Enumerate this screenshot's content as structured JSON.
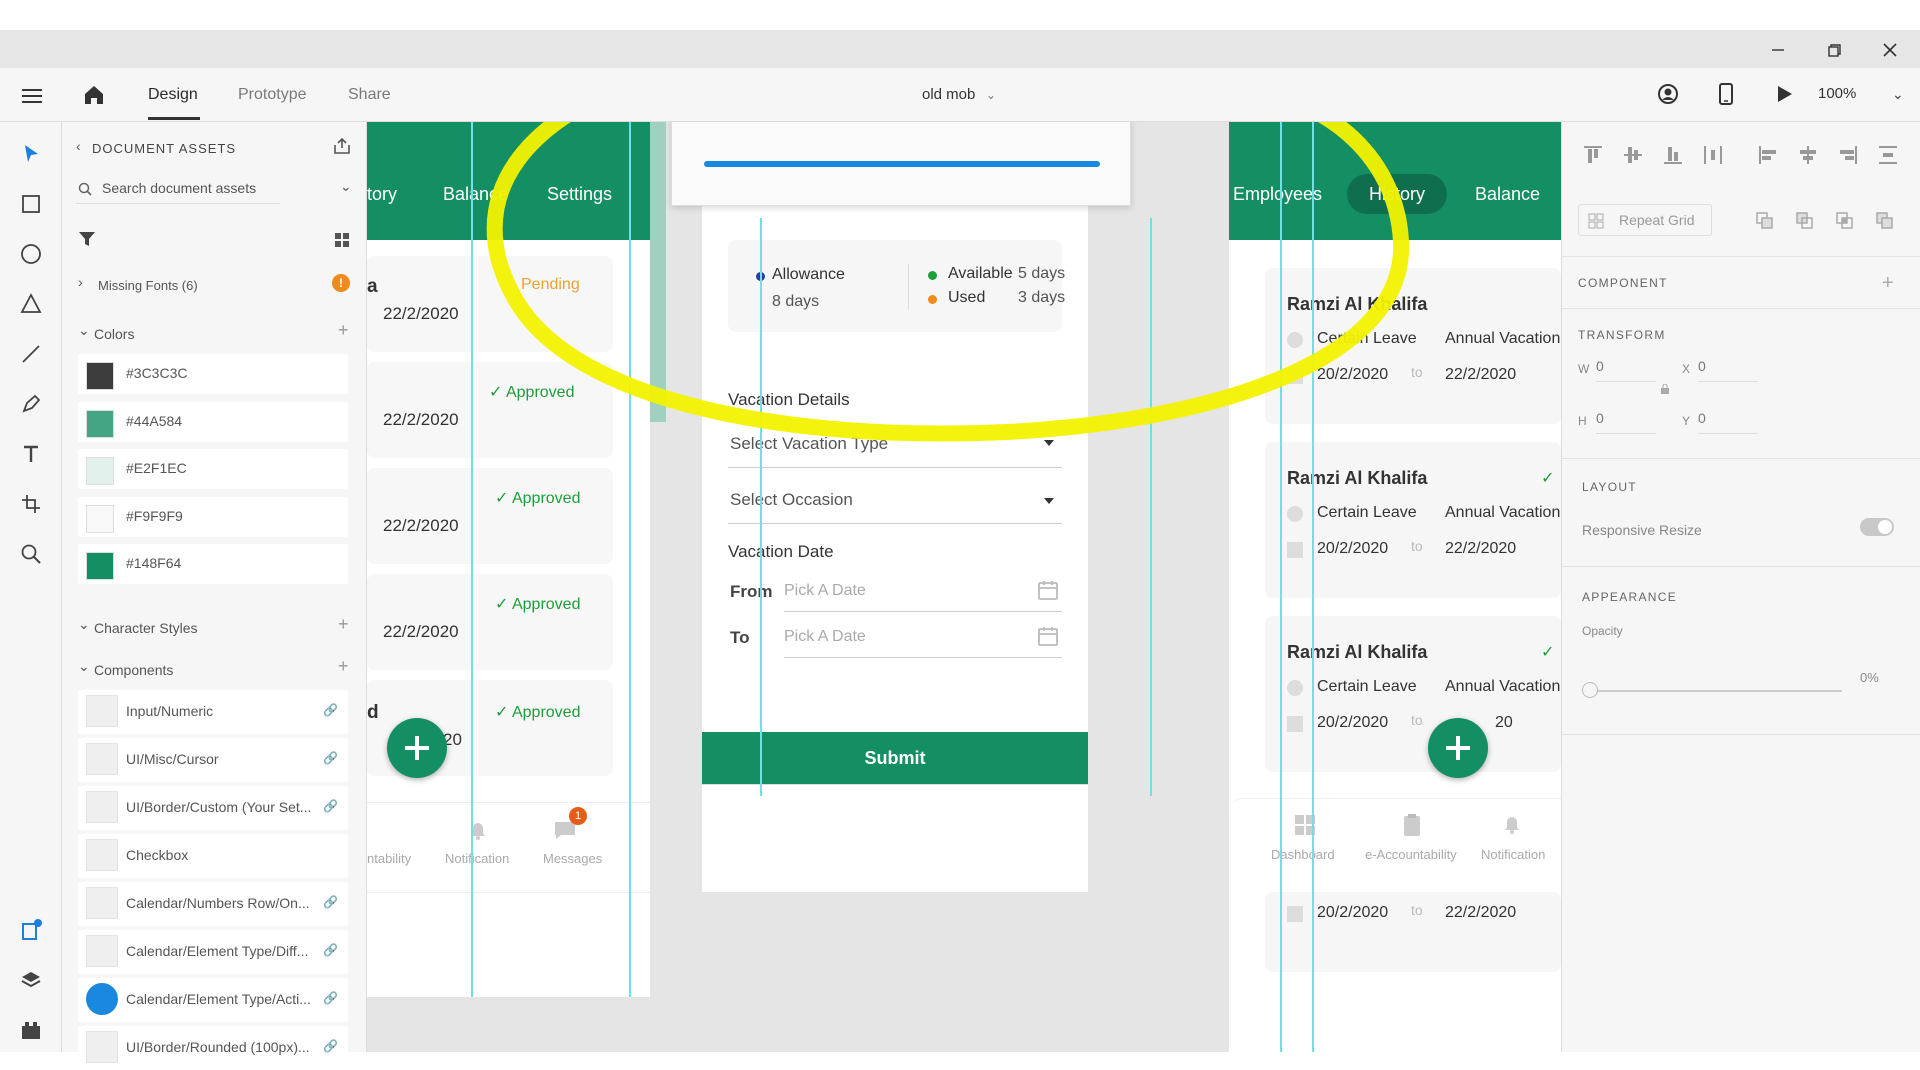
{
  "window": {
    "file_name": "old mob",
    "zoom": "100%"
  },
  "topbar": {
    "tabs": [
      "Design",
      "Prototype",
      "Share"
    ]
  },
  "tools": [
    "select-icon",
    "rectangle-icon",
    "ellipse-icon",
    "polygon-icon",
    "line-icon",
    "pen-icon",
    "text-icon",
    "artboard-icon",
    "zoom-icon",
    "plugins-icon",
    "layers-icon",
    "assets-icon"
  ],
  "assets": {
    "title": "DOCUMENT ASSETS",
    "search_placeholder": "Search document assets",
    "missing_fonts": "Missing Fonts (6)",
    "colors_label": "Colors",
    "colors": [
      "#3C3C3C",
      "#44A584",
      "#E2F1EC",
      "#F9F9F9",
      "#148F64"
    ],
    "char_styles_label": "Character Styles",
    "components_label": "Components",
    "components": [
      "Input/Numeric",
      "UI/Misc/Cursor",
      "UI/Border/Custom (Your Set...",
      "Checkbox",
      "Calendar/Numbers Row/On...",
      "Calendar/Element Type/Diff...",
      "Calendar/Element Type/Acti...",
      "UI/Border/Rounded (100px)..."
    ]
  },
  "left_screen": {
    "tabs": [
      "tory",
      "Balance",
      "Settings"
    ],
    "rows": [
      {
        "name_fragment": "a",
        "date": "22/2/2020",
        "status": "Pending"
      },
      {
        "name_fragment": "",
        "date": "22/2/2020",
        "status": "Approved"
      },
      {
        "name_fragment": "",
        "date": "22/2/2020",
        "status": "Approved"
      },
      {
        "name_fragment": "",
        "date": "22/2/2020",
        "status": "Approved"
      },
      {
        "name_fragment": "d",
        "date": "20",
        "status": "Approved"
      }
    ],
    "nav": [
      "ntability",
      "Notification",
      "Messages"
    ],
    "badge": "1"
  },
  "middle_screen": {
    "allowance_label": "Allowance",
    "allowance_value": "8 days",
    "available_label": "Available",
    "available_value": "5 days",
    "used_label": "Used",
    "used_value": "3 days",
    "vacation_details": "Vacation Details",
    "select_type": "Select Vacation Type",
    "select_occasion": "Select Occasion",
    "vacation_date": "Vacation Date",
    "from_label": "From",
    "to_label": "To",
    "date_placeholder": "Pick A Date",
    "submit": "Submit",
    "progress": 1.0
  },
  "right_screen": {
    "tabs": [
      "Employees",
      "History",
      "Balance"
    ],
    "cards": [
      {
        "name": "Ramzi Al Khalifa",
        "leave_type": "Certain Leave",
        "leave_kind": "Annual Vacation",
        "from": "20/2/2020",
        "to_word": "to",
        "to": "22/2/2020"
      },
      {
        "name": "Ramzi Al Khalifa",
        "leave_type": "Certain Leave",
        "leave_kind": "Annual Vacation",
        "from": "20/2/2020",
        "to_word": "to",
        "to": "22/2/2020"
      },
      {
        "name": "Ramzi Al Khalifa",
        "leave_type": "Certain Leave",
        "leave_kind": "Annual Vacation",
        "from": "20/2/2020",
        "to_word": "to",
        "to": "20"
      }
    ],
    "nav": [
      "Dashboard",
      "e-Accountability",
      "Notification"
    ],
    "bottom_row": {
      "from": "20/2/2020",
      "to_word": "to",
      "to": "22/2/2020"
    }
  },
  "props": {
    "repeat_grid": "Repeat Grid",
    "component": "COMPONENT",
    "transform": "TRANSFORM",
    "w_label": "W",
    "w_value": "0",
    "x_label": "X",
    "x_value": "0",
    "h_label": "H",
    "h_value": "0",
    "y_label": "Y",
    "y_value": "0",
    "layout": "LAYOUT",
    "responsive_resize": "Responsive Resize",
    "appearance": "APPEARANCE",
    "opacity_label": "Opacity",
    "opacity_value": "0%"
  },
  "colors": {
    "brand": "#148F64",
    "approved": "#1E9E3A",
    "pending": "#F0A030",
    "guide": "#6EE0E6",
    "progress": "#1B88E0",
    "annotation": "#F2F200"
  }
}
